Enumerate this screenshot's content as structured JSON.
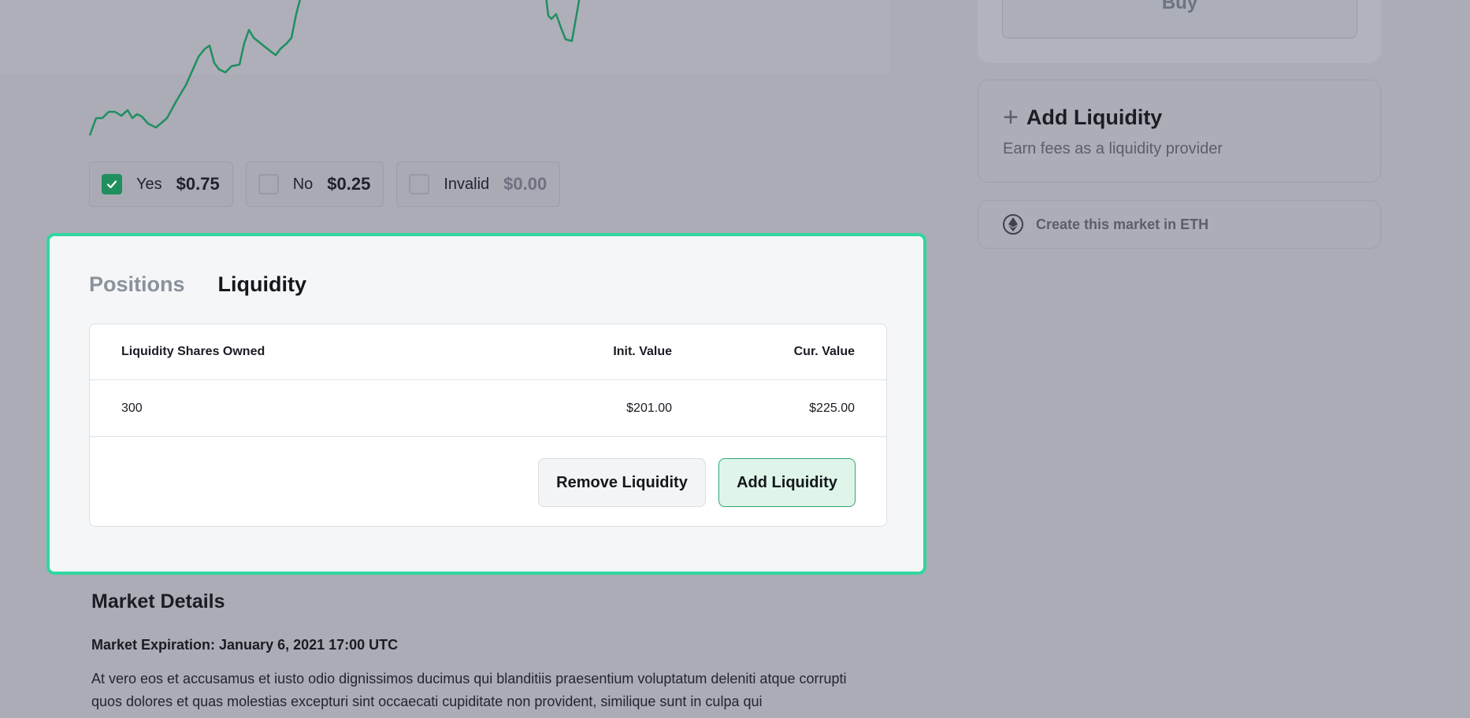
{
  "chart": {
    "line_color": "#1f8f5f"
  },
  "legend": [
    {
      "label": "Yes",
      "price": "$0.75",
      "checked": true
    },
    {
      "label": "No",
      "price": "$0.25",
      "checked": false
    },
    {
      "label": "Invalid",
      "price": "$0.00",
      "checked": false
    }
  ],
  "tabs": [
    {
      "label": "Positions",
      "active": false
    },
    {
      "label": "Liquidity",
      "active": true
    }
  ],
  "table": {
    "headers": [
      "Liquidity Shares Owned",
      "Init. Value",
      "Cur. Value"
    ],
    "rows": [
      [
        "300",
        "$201.00",
        "$225.00"
      ]
    ]
  },
  "actions": {
    "remove_label": "Remove Liquidity",
    "add_label": "Add Liquidity"
  },
  "market_details": {
    "title": "Market Details",
    "expiration": "Market Expiration: January 6, 2021 17:00 UTC",
    "description": "At vero eos et accusamus et iusto odio dignissimos ducimus qui blanditiis praesentium voluptatum deleniti atque corrupti quos dolores et quas molestias excepturi sint occaecati cupiditate non provident, similique sunt in culpa qui"
  },
  "sidebar": {
    "buy_label": "Buy",
    "add_liquidity_title": "Add Liquidity",
    "add_liquidity_subtitle": "Earn fees as a liquidity provider",
    "create_market_label": "Create this market in ETH"
  },
  "colors": {
    "accent": "#33d69f",
    "positive": "#1f8f5f"
  },
  "icons": {
    "check": "check-icon",
    "plus": "plus-icon",
    "eth": "ethereum-icon"
  }
}
